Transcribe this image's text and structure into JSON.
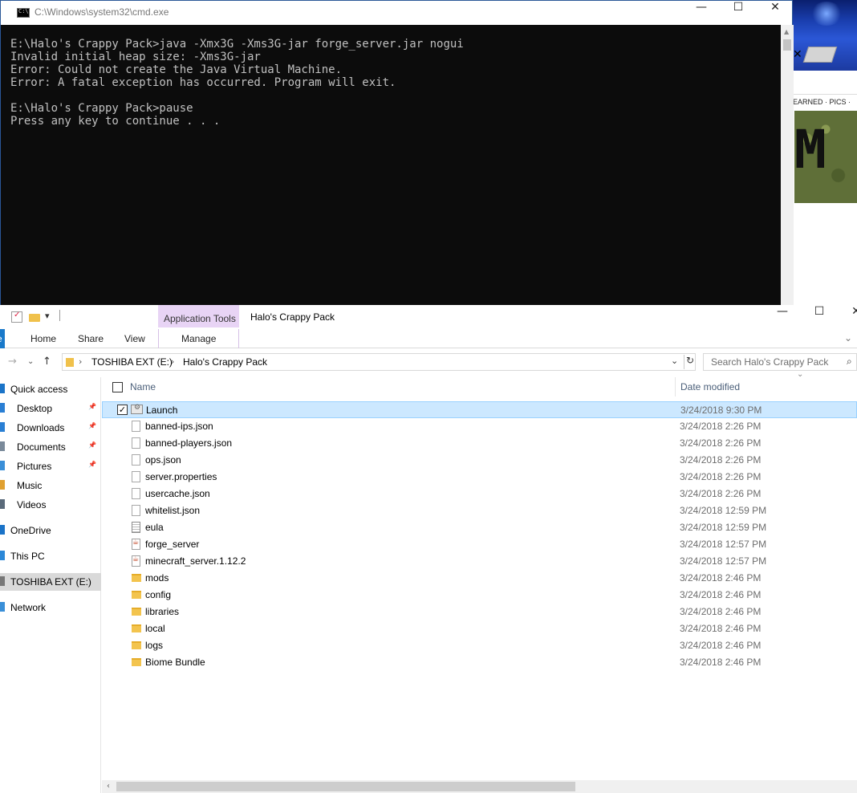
{
  "cmd": {
    "title": "C:\\Windows\\system32\\cmd.exe",
    "lines": [
      "E:\\Halo's Crappy Pack>java -Xmx3G -Xms3G-jar forge_server.jar nogui",
      "Invalid initial heap size: -Xms3G-jar",
      "Error: Could not create the Java Virtual Machine.",
      "Error: A fatal exception has occurred. Program will exit.",
      "",
      "E:\\Halo's Crappy Pack>pause",
      "Press any key to continue . . ."
    ],
    "minimize_glyph": "—",
    "maximize_glyph": "☐",
    "close_glyph": "✕",
    "console_bg": "#0c0c0c",
    "console_fg": "#c0c0c0"
  },
  "browser_bg": {
    "close_tab_glyph": "✕",
    "nav_text": "EARNED · PICS ·",
    "banner_letter": "M"
  },
  "explorer": {
    "title": "Halo's Crappy Pack",
    "context_tab": "Application Tools",
    "context_color": "#e8d4f5",
    "ribbon": {
      "file": "e",
      "home": "Home",
      "share": "Share",
      "view": "View",
      "manage": "Manage"
    },
    "window_buttons": {
      "minimize": "—",
      "maximize": "☐",
      "close": "✕"
    },
    "address": {
      "crumbs": [
        "TOSHIBA EXT (E:)",
        "Halo's Crappy Pack"
      ]
    },
    "search_placeholder": "Search Halo's Crappy Pack",
    "nav_pane": [
      {
        "label": "Quick access",
        "icon": "star-icon",
        "pinned": false
      },
      {
        "label": "Desktop",
        "icon": "desktop-icon",
        "pinned": true
      },
      {
        "label": "Downloads",
        "icon": "downloads-icon",
        "pinned": true
      },
      {
        "label": "Documents",
        "icon": "documents-icon",
        "pinned": true
      },
      {
        "label": "Pictures",
        "icon": "pictures-icon",
        "pinned": true
      },
      {
        "label": "Music",
        "icon": "music-icon",
        "pinned": false
      },
      {
        "label": "Videos",
        "icon": "videos-icon",
        "pinned": false
      },
      {
        "label": "OneDrive",
        "icon": "onedrive-icon",
        "pinned": false
      },
      {
        "label": "This PC",
        "icon": "this-pc-icon",
        "pinned": false
      },
      {
        "label": "TOSHIBA EXT (E:)",
        "icon": "drive-icon",
        "pinned": false,
        "selected": true
      },
      {
        "label": "Network",
        "icon": "network-icon",
        "pinned": false
      }
    ],
    "columns": {
      "name": "Name",
      "date": "Date modified"
    },
    "files": [
      {
        "name": "Launch",
        "date": "3/24/2018 9:30 PM",
        "type": "bat",
        "selected": true,
        "checked": true
      },
      {
        "name": "banned-ips.json",
        "date": "3/24/2018 2:26 PM",
        "type": "file"
      },
      {
        "name": "banned-players.json",
        "date": "3/24/2018 2:26 PM",
        "type": "file"
      },
      {
        "name": "ops.json",
        "date": "3/24/2018 2:26 PM",
        "type": "file"
      },
      {
        "name": "server.properties",
        "date": "3/24/2018 2:26 PM",
        "type": "file"
      },
      {
        "name": "usercache.json",
        "date": "3/24/2018 2:26 PM",
        "type": "file"
      },
      {
        "name": "whitelist.json",
        "date": "3/24/2018 12:59 PM",
        "type": "file"
      },
      {
        "name": "eula",
        "date": "3/24/2018 12:59 PM",
        "type": "text"
      },
      {
        "name": "forge_server",
        "date": "3/24/2018 12:57 PM",
        "type": "jar"
      },
      {
        "name": "minecraft_server.1.12.2",
        "date": "3/24/2018 12:57 PM",
        "type": "jar"
      },
      {
        "name": "mods",
        "date": "3/24/2018 2:46 PM",
        "type": "folder"
      },
      {
        "name": "config",
        "date": "3/24/2018 2:46 PM",
        "type": "folder"
      },
      {
        "name": "libraries",
        "date": "3/24/2018 2:46 PM",
        "type": "folder"
      },
      {
        "name": "local",
        "date": "3/24/2018 2:46 PM",
        "type": "folder"
      },
      {
        "name": "logs",
        "date": "3/24/2018 2:46 PM",
        "type": "folder"
      },
      {
        "name": "Biome Bundle",
        "date": "3/24/2018 2:46 PM",
        "type": "folder"
      }
    ],
    "selection_color": "#cce8ff"
  }
}
